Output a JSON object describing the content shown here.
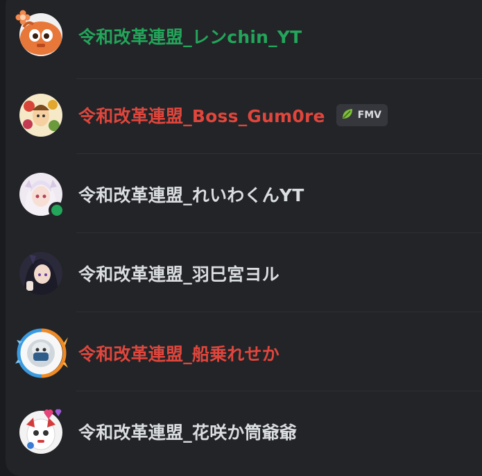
{
  "members": [
    {
      "name": "令和改革連盟_レンchin_YT",
      "color": "#23a55a",
      "badge": null,
      "online": false,
      "avatar": "orange-mascot-avatar"
    },
    {
      "name": "令和改革連盟_Boss_Gum0re",
      "color": "#e0463c",
      "badge": {
        "label": "FMV",
        "icon": "leaf-icon"
      },
      "online": false,
      "avatar": "colorful-character-avatar"
    },
    {
      "name": "令和改革連盟_れいわくんYT",
      "color": "#dbdee1",
      "badge": null,
      "online": true,
      "status_color": "#23a55a",
      "avatar": "white-hair-character-avatar"
    },
    {
      "name": "令和改革連盟_羽巳宮ヨル",
      "color": "#dbdee1",
      "badge": null,
      "online": false,
      "avatar": "dark-hair-character-avatar"
    },
    {
      "name": "令和改革連盟_船乗れせか",
      "color": "#e0463c",
      "badge": null,
      "online": false,
      "avatar": "ice-fire-frame-avatar"
    },
    {
      "name": "令和改革連盟_花咲か筒爺爺",
      "color": "#dbdee1",
      "badge": null,
      "online": false,
      "avatar": "white-creature-avatar"
    }
  ]
}
